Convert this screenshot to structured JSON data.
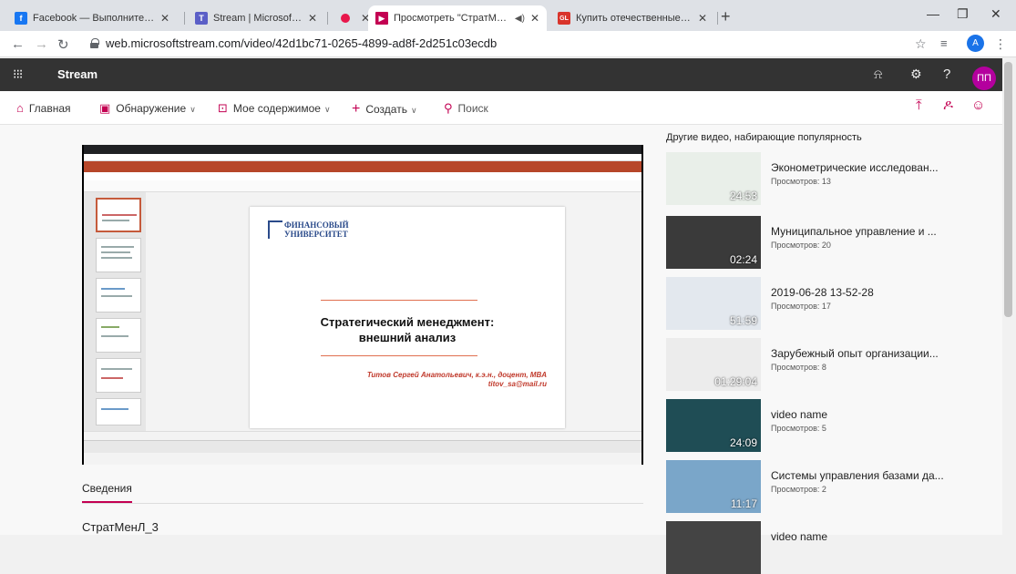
{
  "browser": {
    "tabs": [
      {
        "title": "Facebook — Выполните вход или",
        "color": "#1877f2",
        "glyph": "f"
      },
      {
        "title": "Stream | Microsoft Teams",
        "color": "#5b5fc7",
        "glyph": "T"
      },
      {
        "title": "",
        "color": "#e8174b",
        "glyph": ""
      },
      {
        "title": "Просмотреть \"СтратМенЛ_",
        "color": "#c30052",
        "glyph": "▶"
      },
      {
        "title": "Купить отечественные автомоб",
        "color": "#d9342b",
        "glyph": "GL"
      }
    ],
    "new_tab_label": "+",
    "url": "web.microsoftstream.com/video/42d1bc71-0265-4899-ad8f-2d251c03ecdb",
    "profile_initial": "A"
  },
  "stream": {
    "app_name": "Stream",
    "user_initials": "ПП",
    "menu": {
      "home": "Главная",
      "discover": "Обнаружение",
      "my_content": "Мое содержимое",
      "create": "Создать",
      "search": "Поиск"
    }
  },
  "video": {
    "slide_logo_line1": "ФИНАНСОВЫЙ",
    "slide_logo_line2": "УНИВЕРСИТЕТ",
    "slide_title_line1": "Стратегический менеджмент:",
    "slide_title_line2": "внешний анализ",
    "slide_author_line1": "Титов Сергей Анатольевич, к.э.н., доцент, MBA",
    "slide_author_line2": "titov_sa@mail.ru",
    "details_heading": "Сведения",
    "title": "СтратМенЛ_3"
  },
  "related": {
    "heading": "Другие видео, набирающие популярность",
    "items": [
      {
        "title": "Эконометрические исследован...",
        "views": "Просмотров: 13",
        "duration": "24:53",
        "bg": "#e9efe9"
      },
      {
        "title": "Муниципальное управление и ...",
        "views": "Просмотров: 20",
        "duration": "02:24",
        "bg": "#3a3a3a"
      },
      {
        "title": "2019-06-28 13-52-28",
        "views": "Просмотров: 17",
        "duration": "51:59",
        "bg": "#e3e8ee"
      },
      {
        "title": "Зарубежный опыт организации...",
        "views": "Просмотров: 8",
        "duration": "01:29:04",
        "bg": "#ececec"
      },
      {
        "title": "video name",
        "views": "Просмотров: 5",
        "duration": "24:09",
        "bg": "#1f4d55"
      },
      {
        "title": "Системы управления базами да...",
        "views": "Просмотров: 2",
        "duration": "11:17",
        "bg": "#7aa6c9"
      },
      {
        "title": "video name",
        "views": "",
        "duration": "",
        "bg": "#444"
      }
    ]
  }
}
